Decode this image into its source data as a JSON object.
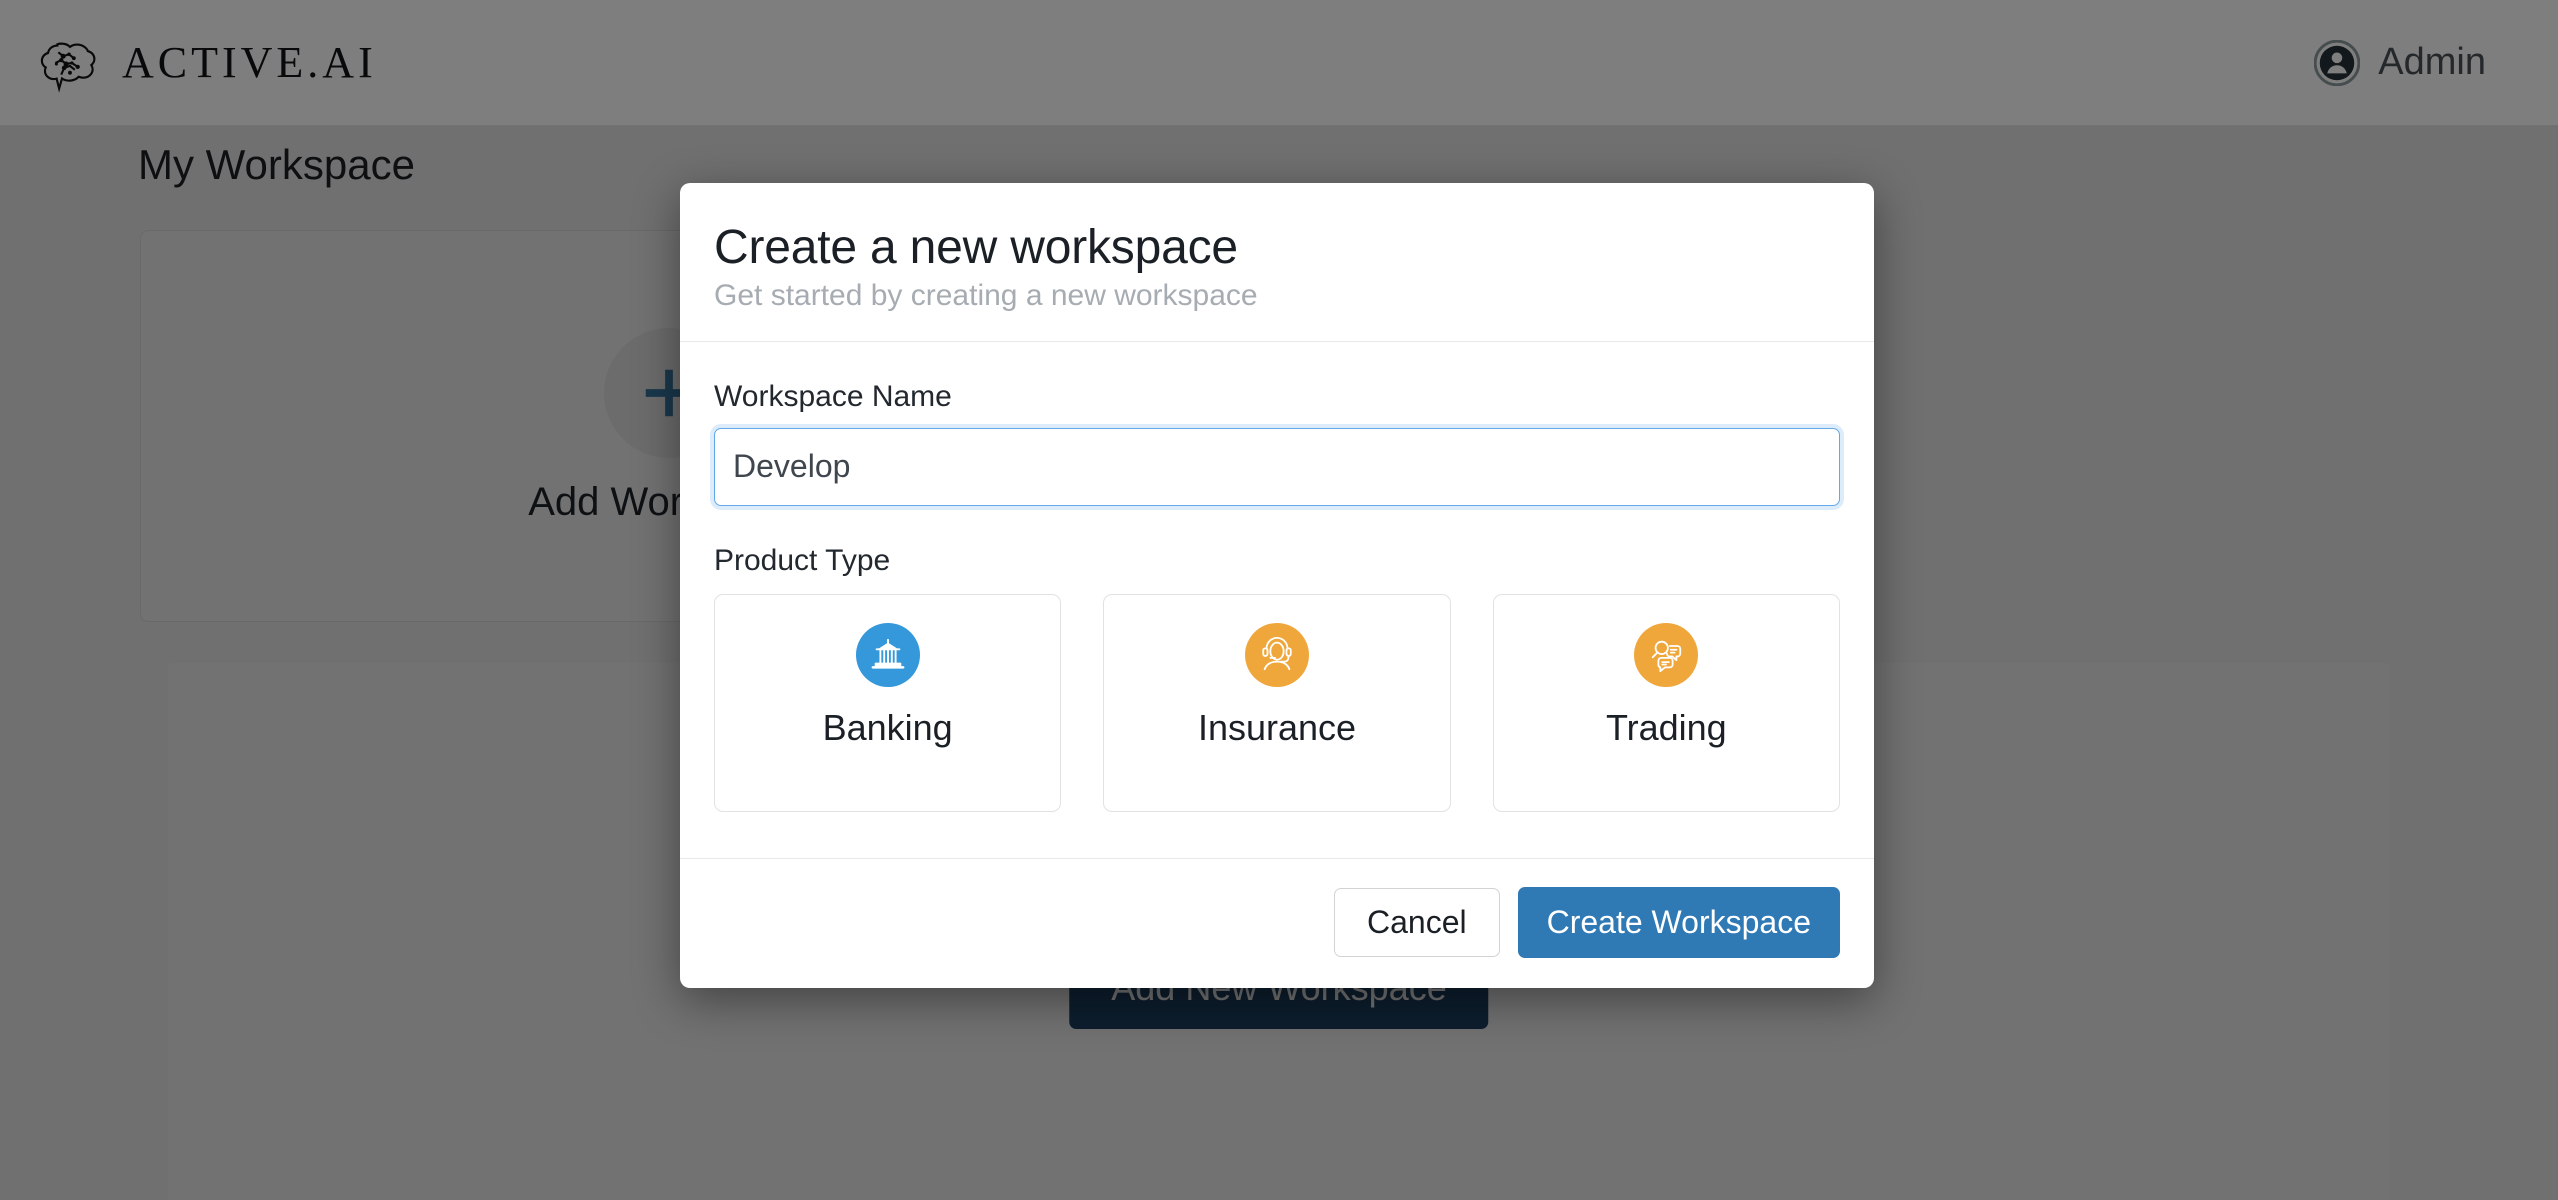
{
  "header": {
    "brand_name": "ACTIVE.AI",
    "brand_icon": "brain-icon",
    "user_name": "Admin",
    "user_icon": "user-avatar-icon"
  },
  "background": {
    "page_title": "My Workspace",
    "add_workspace_card": {
      "label": "Add Workspace",
      "icon": "plus-icon"
    },
    "lower_panel": {
      "illustration": "desktop-monitor-illustration",
      "add_new_button": "Add New Workspace"
    }
  },
  "modal": {
    "title": "Create a new workspace",
    "subtitle": "Get started by creating a new workspace",
    "name_field": {
      "label": "Workspace Name",
      "value": "Develop",
      "placeholder": "Workspace Name"
    },
    "product_type": {
      "label": "Product Type",
      "options": [
        {
          "label": "Banking",
          "icon": "bank-building-icon",
          "color": "#3498db"
        },
        {
          "label": "Insurance",
          "icon": "headset-agent-icon",
          "color": "#efa73c"
        },
        {
          "label": "Trading",
          "icon": "search-chat-bubble-icon",
          "color": "#efa73c"
        }
      ]
    },
    "footer": {
      "cancel_label": "Cancel",
      "submit_label": "Create Workspace"
    }
  },
  "colors": {
    "primary_blue": "#2f79b5",
    "banking_blue": "#3498db",
    "accent_orange": "#efa73c",
    "dark_navy": "#1d4366"
  }
}
